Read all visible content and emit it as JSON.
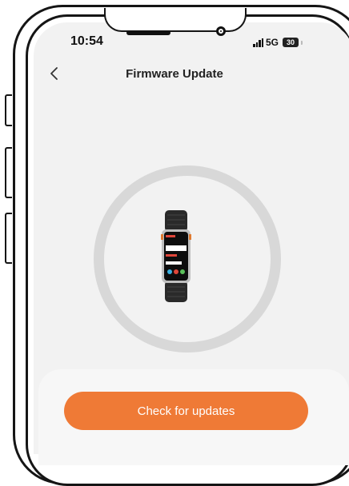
{
  "status_bar": {
    "time": "10:54",
    "network": "5G",
    "battery": "30"
  },
  "header": {
    "title": "Firmware Update",
    "back_icon": "chevron-left-icon"
  },
  "device": {
    "image": "smartwatch-image"
  },
  "actions": {
    "check_updates_label": "Check for updates"
  },
  "colors": {
    "accent": "#ef7a36",
    "ring": "#d8d8d8",
    "screen_background": "#f2f2f2"
  }
}
